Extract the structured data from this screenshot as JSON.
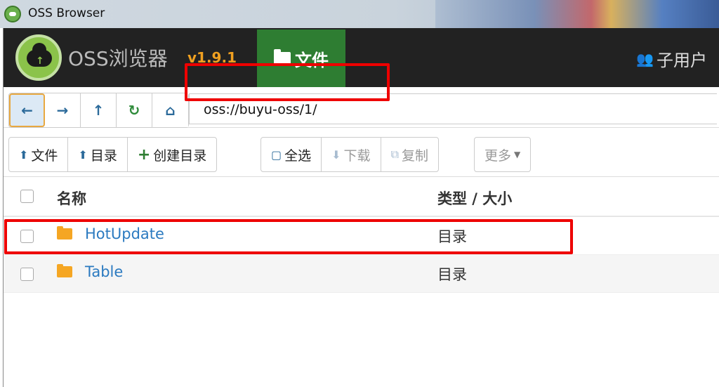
{
  "window": {
    "title": "OSS Browser"
  },
  "header": {
    "brand": "OSS浏览器",
    "version": "v1.9.1",
    "nav_files": "文件",
    "subuser": "子用户"
  },
  "address": {
    "path": "oss://buyu-oss/1/"
  },
  "toolbar": {
    "upload_file": "文件",
    "upload_dir": "目录",
    "create_dir": "创建目录",
    "select_all": "全选",
    "download": "下载",
    "copy": "复制",
    "more": "更多"
  },
  "table": {
    "headers": {
      "name": "名称",
      "type_size": "类型 / 大小"
    },
    "rows": [
      {
        "name": "HotUpdate",
        "type": "目录"
      },
      {
        "name": "Table",
        "type": "目录"
      }
    ]
  },
  "colors": {
    "accent_green": "#2e7d32",
    "version_orange": "#f0a020",
    "link_blue": "#2b7ac0",
    "highlight_red": "#e00000",
    "folder_yellow": "#f5a623"
  },
  "icons": [
    "back-arrow-icon",
    "forward-arrow-icon",
    "up-arrow-icon",
    "refresh-icon",
    "home-icon",
    "upload-icon",
    "plus-icon",
    "select-all-icon",
    "download-icon",
    "copy-icon",
    "folder-icon",
    "users-icon"
  ]
}
